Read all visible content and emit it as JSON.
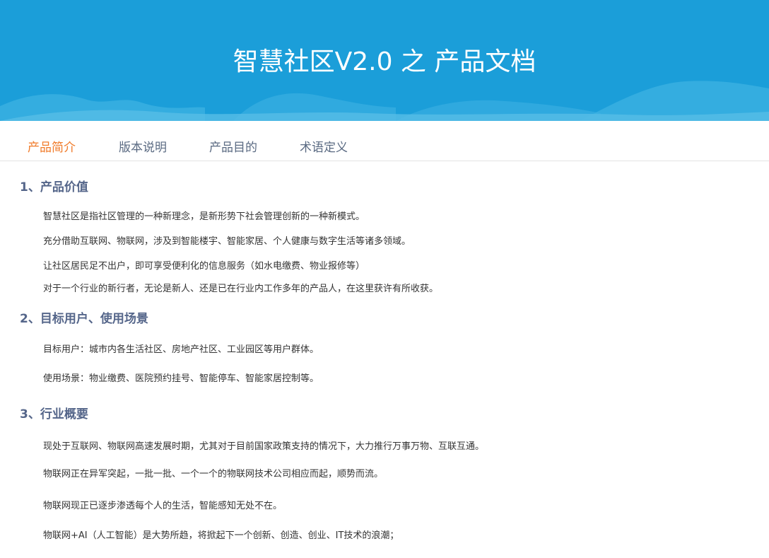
{
  "header": {
    "title": "智慧社区V2.0  之 产品文档"
  },
  "nav": {
    "tabs": [
      {
        "label": "产品简介",
        "active": true
      },
      {
        "label": "版本说明",
        "active": false
      },
      {
        "label": "产品目的",
        "active": false
      },
      {
        "label": "术语定义",
        "active": false
      }
    ]
  },
  "sections": [
    {
      "heading": "1、产品价值",
      "paragraphs": [
        "智慧社区是指社区管理的一种新理念，是新形势下社会管理创新的一种新模式。",
        "充分借助互联网、物联网，涉及到智能楼宇、智能家居、个人健康与数字生活等诸多领域。",
        "让社区居民足不出户，即可享受便利化的信息服务（如水电缴费、物业报修等）",
        "对于一个行业的新行者，无论是新人、还是已在行业内工作多年的产品人，在这里获许有所收获。"
      ]
    },
    {
      "heading": "2、目标用户、使用场景",
      "paragraphs": [
        "目标用户：城市内各生活社区、房地产社区、工业园区等用户群体。",
        "使用场景：物业缴费、医院预约挂号、智能停车、智能家居控制等。"
      ]
    },
    {
      "heading": "3、行业概要",
      "paragraphs": [
        "现处于互联网、物联网高速发展时期，尤其对于目前国家政策支持的情况下，大力推行万事万物、互联互通。",
        "物联网正在异军突起，一批一批、一个一个的物联网技术公司相应而起，顺势而流。",
        "物联网现正已逐步渗透每个人的生活，智能感知无处不在。",
        "物联网+AI（人工智能）是大势所趋，将掀起下一个创新、创造、创业、IT技术的浪潮；"
      ]
    }
  ],
  "colors": {
    "banner": "#1b9ed9",
    "active_tab": "#f07b2a",
    "tab": "#5a6a82",
    "heading": "#55668a"
  }
}
